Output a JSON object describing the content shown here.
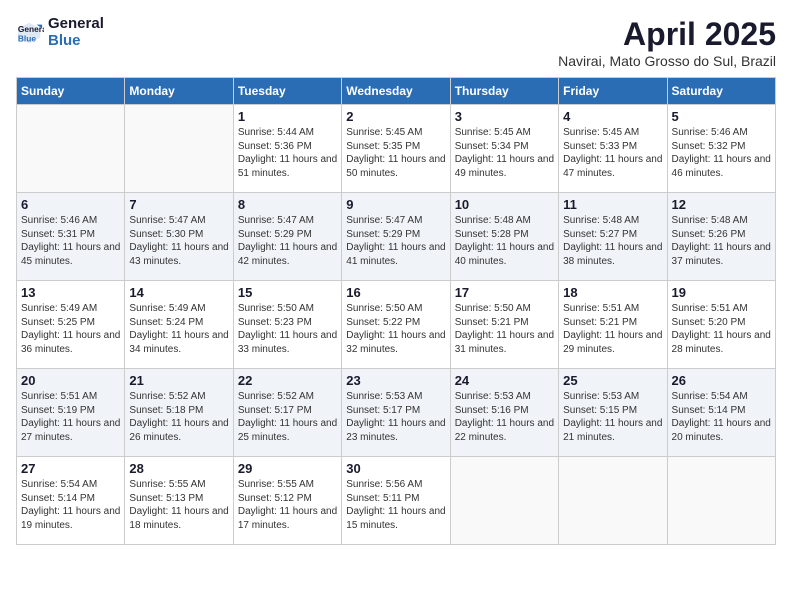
{
  "header": {
    "logo_line1": "General",
    "logo_line2": "Blue",
    "month_title": "April 2025",
    "location": "Navirai, Mato Grosso do Sul, Brazil"
  },
  "days_of_week": [
    "Sunday",
    "Monday",
    "Tuesday",
    "Wednesday",
    "Thursday",
    "Friday",
    "Saturday"
  ],
  "weeks": [
    [
      {
        "day": "",
        "info": ""
      },
      {
        "day": "",
        "info": ""
      },
      {
        "day": "1",
        "info": "Sunrise: 5:44 AM\nSunset: 5:36 PM\nDaylight: 11 hours and 51 minutes."
      },
      {
        "day": "2",
        "info": "Sunrise: 5:45 AM\nSunset: 5:35 PM\nDaylight: 11 hours and 50 minutes."
      },
      {
        "day": "3",
        "info": "Sunrise: 5:45 AM\nSunset: 5:34 PM\nDaylight: 11 hours and 49 minutes."
      },
      {
        "day": "4",
        "info": "Sunrise: 5:45 AM\nSunset: 5:33 PM\nDaylight: 11 hours and 47 minutes."
      },
      {
        "day": "5",
        "info": "Sunrise: 5:46 AM\nSunset: 5:32 PM\nDaylight: 11 hours and 46 minutes."
      }
    ],
    [
      {
        "day": "6",
        "info": "Sunrise: 5:46 AM\nSunset: 5:31 PM\nDaylight: 11 hours and 45 minutes."
      },
      {
        "day": "7",
        "info": "Sunrise: 5:47 AM\nSunset: 5:30 PM\nDaylight: 11 hours and 43 minutes."
      },
      {
        "day": "8",
        "info": "Sunrise: 5:47 AM\nSunset: 5:29 PM\nDaylight: 11 hours and 42 minutes."
      },
      {
        "day": "9",
        "info": "Sunrise: 5:47 AM\nSunset: 5:29 PM\nDaylight: 11 hours and 41 minutes."
      },
      {
        "day": "10",
        "info": "Sunrise: 5:48 AM\nSunset: 5:28 PM\nDaylight: 11 hours and 40 minutes."
      },
      {
        "day": "11",
        "info": "Sunrise: 5:48 AM\nSunset: 5:27 PM\nDaylight: 11 hours and 38 minutes."
      },
      {
        "day": "12",
        "info": "Sunrise: 5:48 AM\nSunset: 5:26 PM\nDaylight: 11 hours and 37 minutes."
      }
    ],
    [
      {
        "day": "13",
        "info": "Sunrise: 5:49 AM\nSunset: 5:25 PM\nDaylight: 11 hours and 36 minutes."
      },
      {
        "day": "14",
        "info": "Sunrise: 5:49 AM\nSunset: 5:24 PM\nDaylight: 11 hours and 34 minutes."
      },
      {
        "day": "15",
        "info": "Sunrise: 5:50 AM\nSunset: 5:23 PM\nDaylight: 11 hours and 33 minutes."
      },
      {
        "day": "16",
        "info": "Sunrise: 5:50 AM\nSunset: 5:22 PM\nDaylight: 11 hours and 32 minutes."
      },
      {
        "day": "17",
        "info": "Sunrise: 5:50 AM\nSunset: 5:21 PM\nDaylight: 11 hours and 31 minutes."
      },
      {
        "day": "18",
        "info": "Sunrise: 5:51 AM\nSunset: 5:21 PM\nDaylight: 11 hours and 29 minutes."
      },
      {
        "day": "19",
        "info": "Sunrise: 5:51 AM\nSunset: 5:20 PM\nDaylight: 11 hours and 28 minutes."
      }
    ],
    [
      {
        "day": "20",
        "info": "Sunrise: 5:51 AM\nSunset: 5:19 PM\nDaylight: 11 hours and 27 minutes."
      },
      {
        "day": "21",
        "info": "Sunrise: 5:52 AM\nSunset: 5:18 PM\nDaylight: 11 hours and 26 minutes."
      },
      {
        "day": "22",
        "info": "Sunrise: 5:52 AM\nSunset: 5:17 PM\nDaylight: 11 hours and 25 minutes."
      },
      {
        "day": "23",
        "info": "Sunrise: 5:53 AM\nSunset: 5:17 PM\nDaylight: 11 hours and 23 minutes."
      },
      {
        "day": "24",
        "info": "Sunrise: 5:53 AM\nSunset: 5:16 PM\nDaylight: 11 hours and 22 minutes."
      },
      {
        "day": "25",
        "info": "Sunrise: 5:53 AM\nSunset: 5:15 PM\nDaylight: 11 hours and 21 minutes."
      },
      {
        "day": "26",
        "info": "Sunrise: 5:54 AM\nSunset: 5:14 PM\nDaylight: 11 hours and 20 minutes."
      }
    ],
    [
      {
        "day": "27",
        "info": "Sunrise: 5:54 AM\nSunset: 5:14 PM\nDaylight: 11 hours and 19 minutes."
      },
      {
        "day": "28",
        "info": "Sunrise: 5:55 AM\nSunset: 5:13 PM\nDaylight: 11 hours and 18 minutes."
      },
      {
        "day": "29",
        "info": "Sunrise: 5:55 AM\nSunset: 5:12 PM\nDaylight: 11 hours and 17 minutes."
      },
      {
        "day": "30",
        "info": "Sunrise: 5:56 AM\nSunset: 5:11 PM\nDaylight: 11 hours and 15 minutes."
      },
      {
        "day": "",
        "info": ""
      },
      {
        "day": "",
        "info": ""
      },
      {
        "day": "",
        "info": ""
      }
    ]
  ]
}
